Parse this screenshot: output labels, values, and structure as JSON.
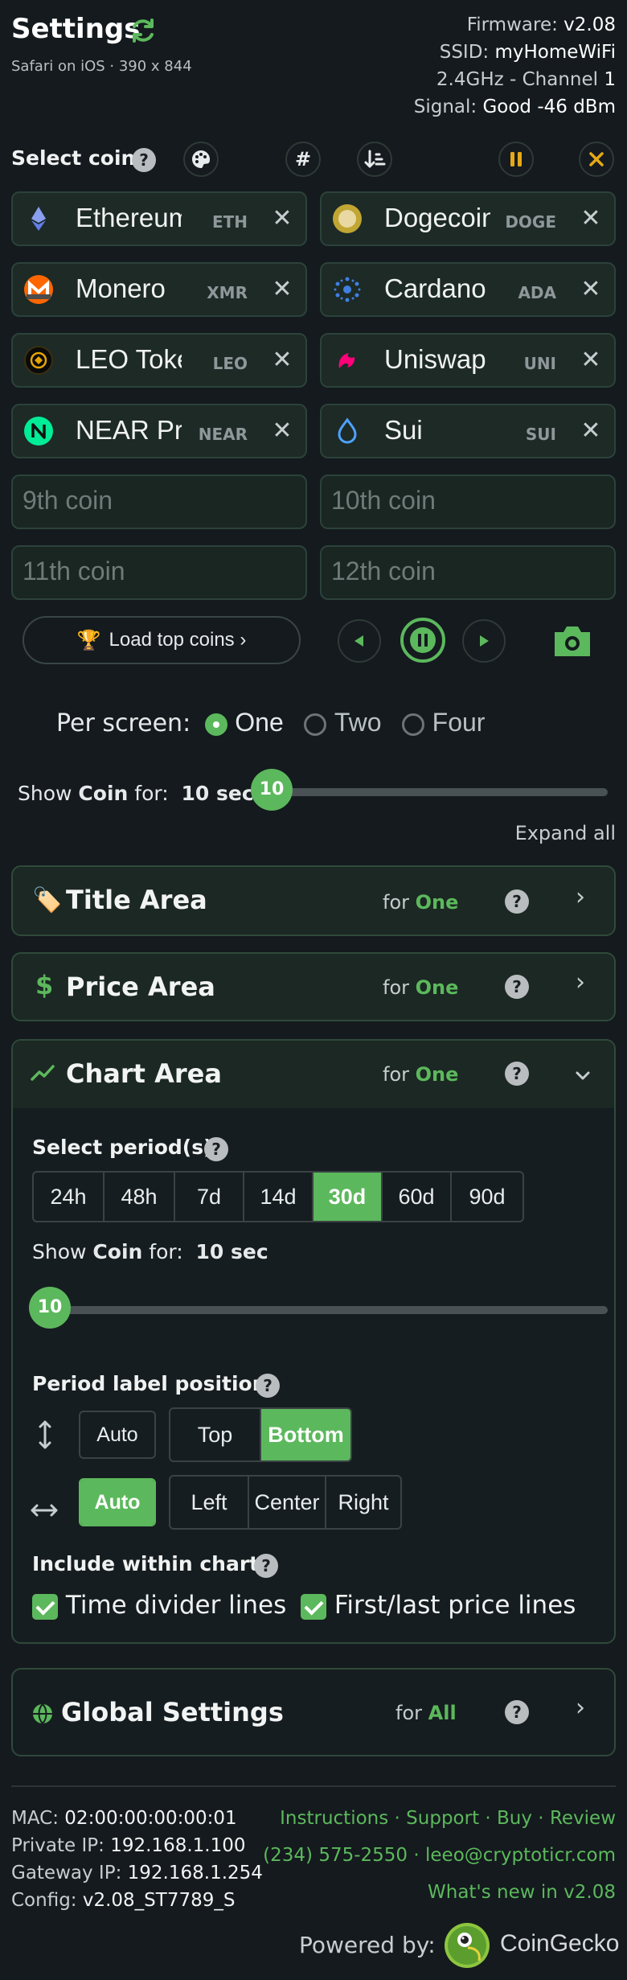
{
  "header": {
    "title": "Settings",
    "subtitle": "Safari on iOS · 390 x 844",
    "firmware_label": "Firmware:",
    "firmware": "v2.08",
    "ssid_label": "SSID:",
    "ssid": "myHomeWiFi",
    "band_label": "2.4GHz - Channel",
    "channel": "1",
    "signal_label": "Signal:",
    "signal": "Good -46 dBm"
  },
  "select_coins": {
    "label": "Select coins",
    "help": "?",
    "hash_label": "#",
    "coins": [
      {
        "name": "Ethereum",
        "ticker": "ETH",
        "icon": "ethereum-icon",
        "color": "#627eea"
      },
      {
        "name": "Dogecoin",
        "ticker": "DOGE",
        "icon": "dogecoin-icon",
        "color": "#c2a633"
      },
      {
        "name": "Monero",
        "ticker": "XMR",
        "icon": "monero-icon",
        "color": "#ff6600"
      },
      {
        "name": "Cardano",
        "ticker": "ADA",
        "icon": "cardano-icon",
        "color": "#2a71d0"
      },
      {
        "name": "LEO Token",
        "ticker": "LEO",
        "icon": "leo-icon",
        "color": "#e6a500"
      },
      {
        "name": "Uniswap",
        "ticker": "UNI",
        "icon": "uniswap-icon",
        "color": "#ff007a"
      },
      {
        "name": "NEAR Protocol",
        "ticker": "NEAR",
        "icon": "near-icon",
        "color": "#00ec97"
      },
      {
        "name": "Sui",
        "ticker": "SUI",
        "icon": "sui-icon",
        "color": "#4da2ff"
      }
    ],
    "placeholders": [
      "9th coin",
      "10th coin",
      "11th coin",
      "12th coin"
    ],
    "load_top": "Load top coins ›"
  },
  "per_screen": {
    "label": "Per screen:",
    "options": [
      "One",
      "Two",
      "Four"
    ],
    "selected": "One"
  },
  "show_coin": {
    "prefix": "Show",
    "word": "Coin",
    "suffix": "for:",
    "value": "10 sec",
    "slider_value": "10",
    "slider_fraction": 0.0
  },
  "expand_all": "Expand all",
  "sections": {
    "title_area": {
      "title": "Title Area",
      "for": "for",
      "scope": "One",
      "help": "?",
      "chev": "›"
    },
    "price_area": {
      "title": "Price Area",
      "for": "for",
      "scope": "One",
      "help": "?",
      "chev": "›"
    },
    "chart_area": {
      "title": "Chart Area",
      "for": "for",
      "scope": "One",
      "help": "?",
      "chev": "⌄"
    },
    "global": {
      "title": "Global Settings",
      "for": "for",
      "scope": "All",
      "help": "?",
      "chev": "›"
    }
  },
  "chart_area": {
    "period_label": "Select period(s):",
    "periods": [
      "24h",
      "48h",
      "7d",
      "14d",
      "30d",
      "60d",
      "90d"
    ],
    "selected_period": "30d",
    "show_prefix": "Show",
    "show_word": "Coin",
    "show_suffix": "for:",
    "show_value": "10 sec",
    "slider_value": "10",
    "position_label": "Period label position:",
    "vertical_auto": "Auto",
    "vertical_options": [
      "Top",
      "Bottom"
    ],
    "vertical_selected": "Bottom",
    "horizontal_auto": "Auto",
    "horizontal_options": [
      "Left",
      "Center",
      "Right"
    ],
    "horizontal_selected": "Auto",
    "include_label": "Include within chart:",
    "include_options": [
      "Time divider lines",
      "First/last price lines"
    ]
  },
  "footer": {
    "mac_label": "MAC:",
    "mac": "02:00:00:00:00:01",
    "private_ip_label": "Private IP:",
    "private_ip": "192.168.1.100",
    "gateway_ip_label": "Gateway IP:",
    "gateway_ip": "192.168.1.254",
    "config_label": "Config:",
    "config": "v2.08_ST7789_S",
    "links": [
      "Instructions",
      "Support",
      "Buy",
      "Review"
    ],
    "phone": "(234) 575-2550",
    "email": "leeo@cryptoticr.com",
    "whats_new": "What's new in v2.08",
    "powered_by": "Powered by:",
    "brand": "CoinGecko"
  },
  "colors": {
    "accent": "#5cb85c",
    "pause": "#e6a817",
    "background": "#141a1e"
  }
}
